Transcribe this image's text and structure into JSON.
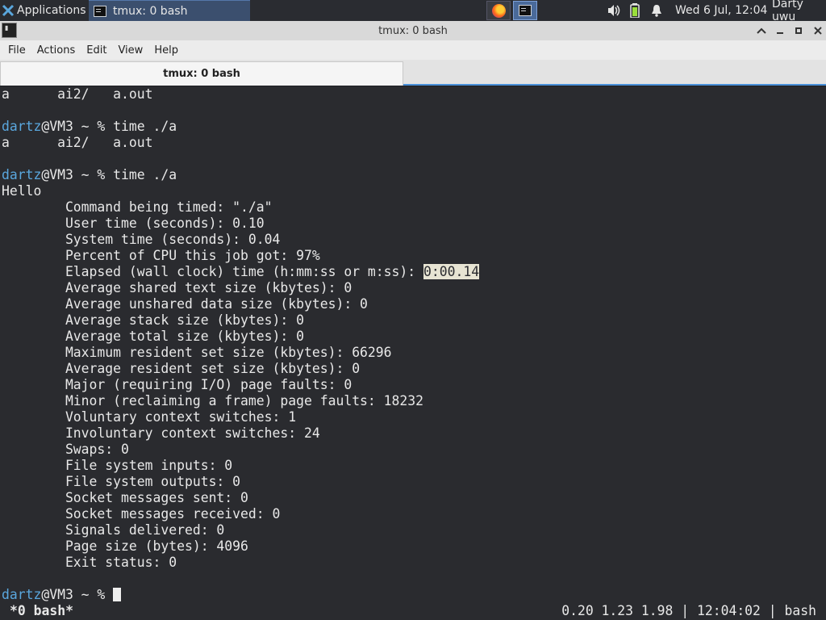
{
  "panel": {
    "applications_label": "Applications",
    "task_label": "tmux: 0 bash",
    "clock": "Wed  6 Jul, 12:04",
    "user": "Darty uwu",
    "icons": [
      "xfce-icon",
      "terminal-icon",
      "firefox-icon",
      "terminal-launcher-icon",
      "volume-icon",
      "battery-icon",
      "notification-bell-icon"
    ]
  },
  "window": {
    "title": "tmux: 0 bash",
    "controls": [
      "shade",
      "minimize",
      "maximize",
      "close"
    ]
  },
  "menubar": {
    "items": [
      "File",
      "Actions",
      "Edit",
      "View",
      "Help"
    ]
  },
  "tabs": [
    {
      "label": "tmux: 0 bash",
      "active": true
    }
  ],
  "terminal": {
    "lines": [
      {
        "text": "a      ai2/   a.out"
      },
      {
        "text": ""
      },
      {
        "prompt_user": "dartz",
        "prompt_rest": "@VM3 ~ % ",
        "cmd": "time ./a"
      },
      {
        "text": "a      ai2/   a.out"
      },
      {
        "text": ""
      },
      {
        "prompt_user": "dartz",
        "prompt_rest": "@VM3 ~ % ",
        "cmd": "time ./a"
      },
      {
        "text": "Hello"
      },
      {
        "text": "        Command being timed: \"./a\""
      },
      {
        "text": "        User time (seconds): 0.10"
      },
      {
        "text": "        System time (seconds): 0.04"
      },
      {
        "text": "        Percent of CPU this job got: 97%"
      },
      {
        "text": "        Elapsed (wall clock) time (h:mm:ss or m:ss): ",
        "highlight": "0:00.14"
      },
      {
        "text": "        Average shared text size (kbytes): 0"
      },
      {
        "text": "        Average unshared data size (kbytes): 0"
      },
      {
        "text": "        Average stack size (kbytes): 0"
      },
      {
        "text": "        Average total size (kbytes): 0"
      },
      {
        "text": "        Maximum resident set size (kbytes): 66296"
      },
      {
        "text": "        Average resident set size (kbytes): 0"
      },
      {
        "text": "        Major (requiring I/O) page faults: 0"
      },
      {
        "text": "        Minor (reclaiming a frame) page faults: 18232"
      },
      {
        "text": "        Voluntary context switches: 1"
      },
      {
        "text": "        Involuntary context switches: 24"
      },
      {
        "text": "        Swaps: 0"
      },
      {
        "text": "        File system inputs: 0"
      },
      {
        "text": "        File system outputs: 0"
      },
      {
        "text": "        Socket messages sent: 0"
      },
      {
        "text": "        Socket messages received: 0"
      },
      {
        "text": "        Signals delivered: 0"
      },
      {
        "text": "        Page size (bytes): 4096"
      },
      {
        "text": "        Exit status: 0"
      },
      {
        "text": ""
      },
      {
        "prompt_user": "dartz",
        "prompt_rest": "@VM3 ~ % ",
        "cmd": "",
        "cursor": true
      }
    ]
  },
  "tmux_status": {
    "left": "*0 bash*",
    "right": "0.20 1.23 1.98 | 12:04:02 | bash"
  },
  "colors": {
    "prompt_user": "#5aa7de",
    "terminal_bg": "#2a2b2f",
    "panel_bg": "#2a2c31"
  }
}
